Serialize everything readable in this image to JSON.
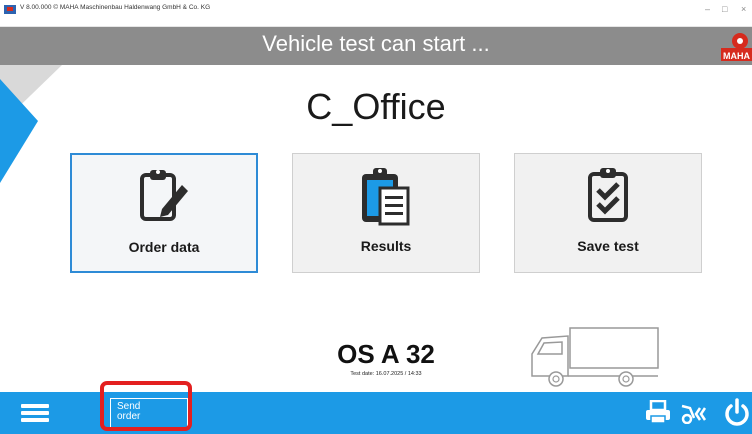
{
  "window": {
    "title": "V 8.00.000  © MAHA Maschinenbau Haldenwang GmbH & Co. KG",
    "minimize": "–",
    "maximize": "□",
    "close": "×"
  },
  "header": {
    "title": "Vehicle test can start ...",
    "logo_text": "MAHA"
  },
  "workplace": "C_Office",
  "tiles": [
    {
      "label": "Order data",
      "icon": "clipboard-pencil-icon",
      "active": true
    },
    {
      "label": "Results",
      "icon": "clipboard-list-icon",
      "active": false
    },
    {
      "label": "Save test",
      "icon": "clipboard-check-icon",
      "active": false
    }
  ],
  "vehicle": {
    "plate": "OS A 32",
    "test_date": "Test date: 16.07.2025 / 14:33",
    "type_icon": "truck-icon"
  },
  "bottombar": {
    "menu_icon": "hamburger-menu-icon",
    "send_order_label": "Send order",
    "icons": [
      "printer-icon",
      "vehicle-icon",
      "power-icon"
    ]
  },
  "colors": {
    "accent": "#1c9ae6",
    "header": "#8c8c8c",
    "highlight": "#e32020",
    "brand_red": "#d62b1e"
  }
}
